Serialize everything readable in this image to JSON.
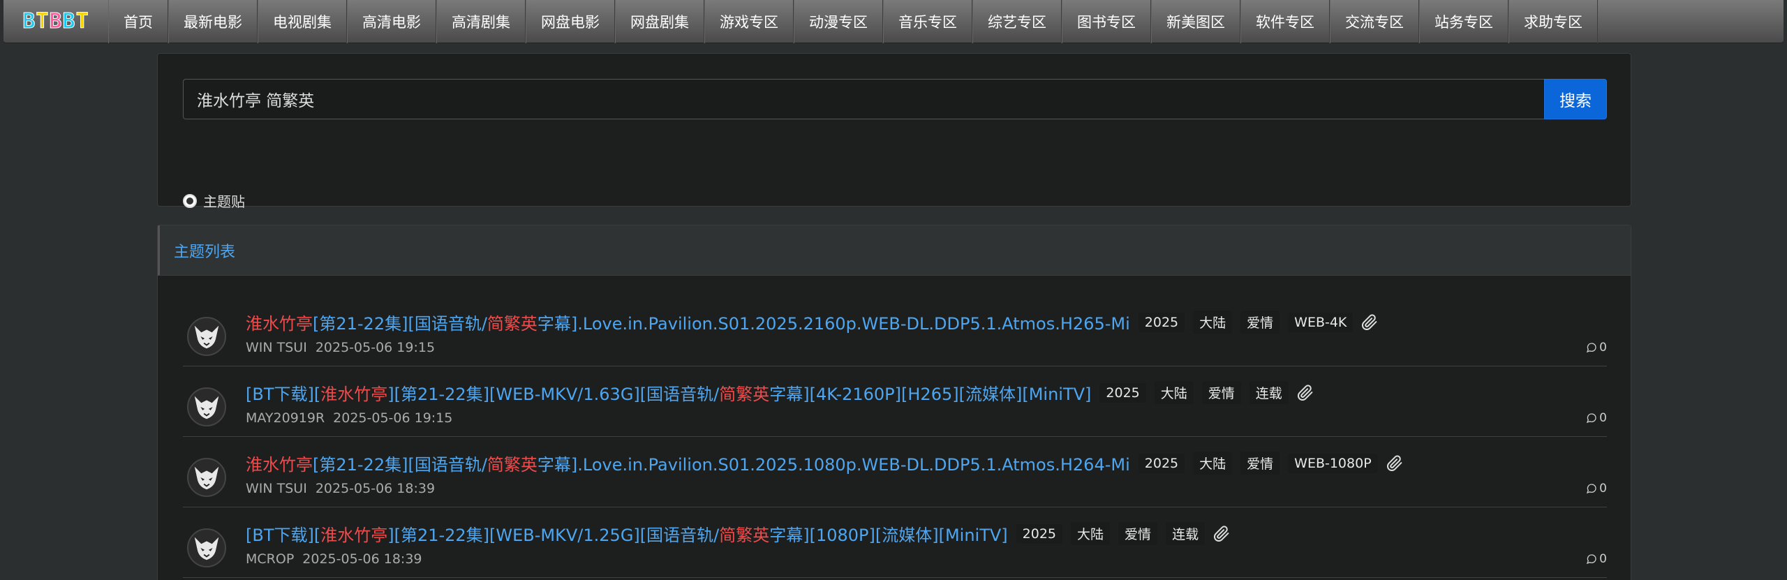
{
  "nav": {
    "logo": "BTBBT",
    "logo_colors": [
      "#1ec8f0",
      "#f5d200",
      "#ff5aa0",
      "#1ec8f0",
      "#f5d200"
    ],
    "items": [
      "首页",
      "最新电影",
      "电视剧集",
      "高清电影",
      "高清剧集",
      "网盘电影",
      "网盘剧集",
      "游戏专区",
      "动漫专区",
      "音乐专区",
      "综艺专区",
      "图书专区",
      "新美图区",
      "软件专区",
      "交流专区",
      "站务专区",
      "求助专区"
    ]
  },
  "search": {
    "value": "淮水竹亭 简繁英",
    "button": "搜索",
    "radio_label": "主题贴"
  },
  "list": {
    "header": "主题列表",
    "threads": [
      {
        "segments": [
          {
            "text": "淮水竹亭",
            "hl": true
          },
          {
            "text": "[第21-22集][国语音轨/",
            "hl": false
          },
          {
            "text": "简繁英",
            "hl": true
          },
          {
            "text": "字幕].Love.in.Pavilion.S01.2025.2160p.WEB-DL.DDP5.1.Atmos.H265-Mi",
            "hl": false
          }
        ],
        "tags": [
          "2025",
          "大陆",
          "爱情",
          "WEB-4K"
        ],
        "author": "WIN TSUI",
        "time": "2025-05-06 19:15",
        "replies": "0"
      },
      {
        "segments": [
          {
            "text": "[BT下载][",
            "hl": false
          },
          {
            "text": "淮水竹亭",
            "hl": true
          },
          {
            "text": "][第21-22集][WEB-MKV/1.63G][国语音轨/",
            "hl": false
          },
          {
            "text": "简繁英",
            "hl": true
          },
          {
            "text": "字幕][4K-2160P][H265][流媒体][MiniTV]",
            "hl": false
          }
        ],
        "tags": [
          "2025",
          "大陆",
          "爱情",
          "连载"
        ],
        "author": "MAY20919R",
        "time": "2025-05-06 19:15",
        "replies": "0"
      },
      {
        "segments": [
          {
            "text": "淮水竹亭",
            "hl": true
          },
          {
            "text": "[第21-22集][国语音轨/",
            "hl": false
          },
          {
            "text": "简繁英",
            "hl": true
          },
          {
            "text": "字幕].Love.in.Pavilion.S01.2025.1080p.WEB-DL.DDP5.1.Atmos.H264-Mi",
            "hl": false
          }
        ],
        "tags": [
          "2025",
          "大陆",
          "爱情",
          "WEB-1080P"
        ],
        "author": "WIN TSUI",
        "time": "2025-05-06 18:39",
        "replies": "0"
      },
      {
        "segments": [
          {
            "text": "[BT下载][",
            "hl": false
          },
          {
            "text": "淮水竹亭",
            "hl": true
          },
          {
            "text": "][第21-22集][WEB-MKV/1.25G][国语音轨/",
            "hl": false
          },
          {
            "text": "简繁英",
            "hl": true
          },
          {
            "text": "字幕][1080P][流媒体][MiniTV]",
            "hl": false
          }
        ],
        "tags": [
          "2025",
          "大陆",
          "爱情",
          "连载"
        ],
        "author": "MCROP",
        "time": "2025-05-06 18:39",
        "replies": "0"
      }
    ]
  },
  "icons": {
    "attachment": "paperclip-icon",
    "reply": "comment-icon",
    "avatar": "demon-mask-avatar-icon"
  },
  "colors": {
    "accent": "#0a66d9",
    "link": "#4ea6f0",
    "highlight": "#ef4b4b"
  }
}
